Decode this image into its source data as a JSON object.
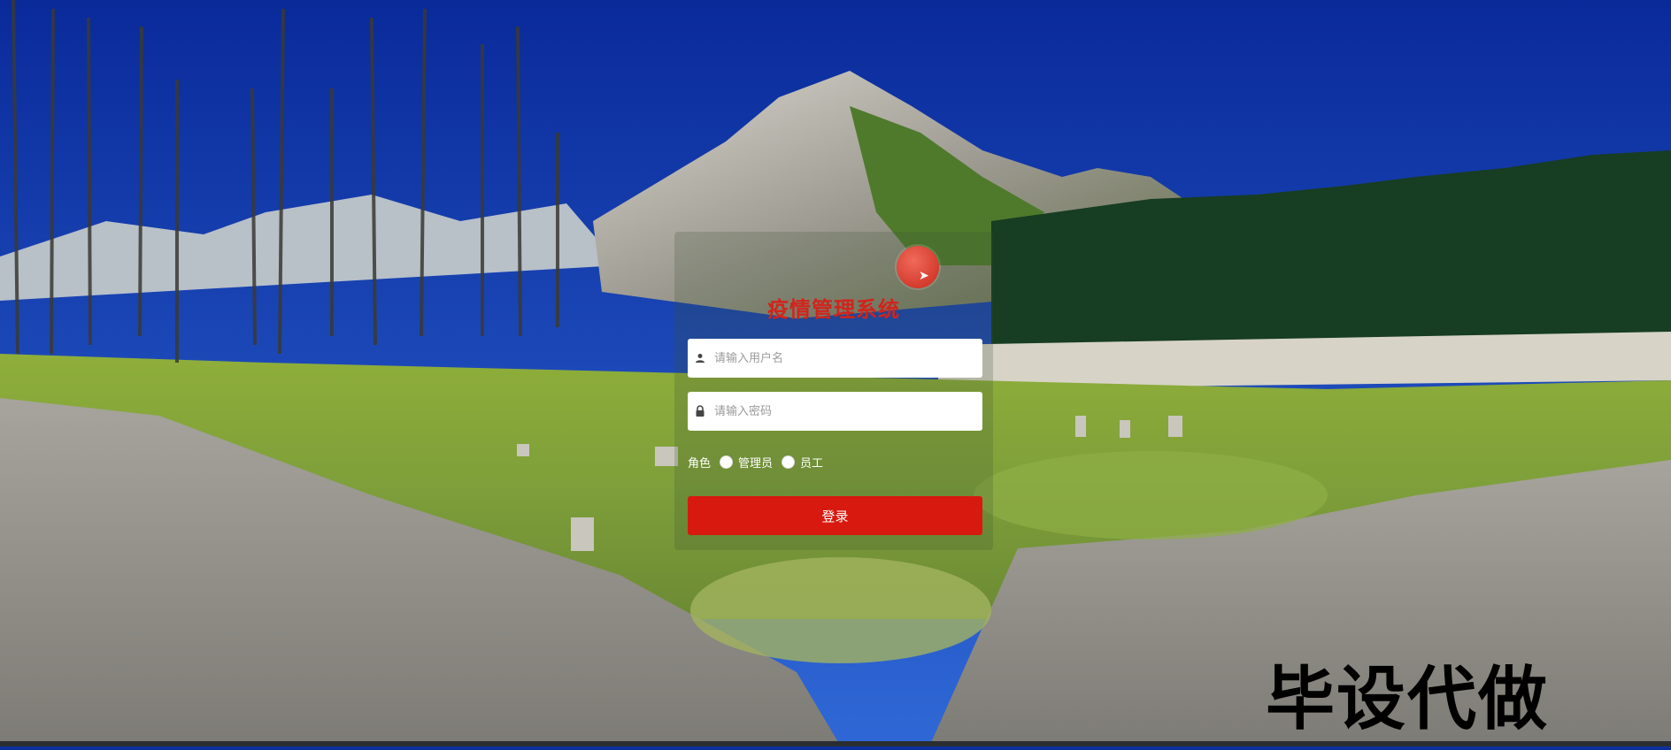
{
  "login": {
    "title": "疫情管理系统",
    "username_placeholder": "请输入用户名",
    "password_placeholder": "请输入密码",
    "role_label": "角色",
    "role_options": [
      "管理员",
      "员工"
    ],
    "submit_label": "登录"
  },
  "watermark": "毕设代做",
  "icons": {
    "username": "user-icon",
    "password": "lock-icon",
    "avatar": "avatar-icon"
  },
  "colors": {
    "accent": "#d8190f",
    "title": "#d3231b",
    "sky": "#1446c8"
  }
}
